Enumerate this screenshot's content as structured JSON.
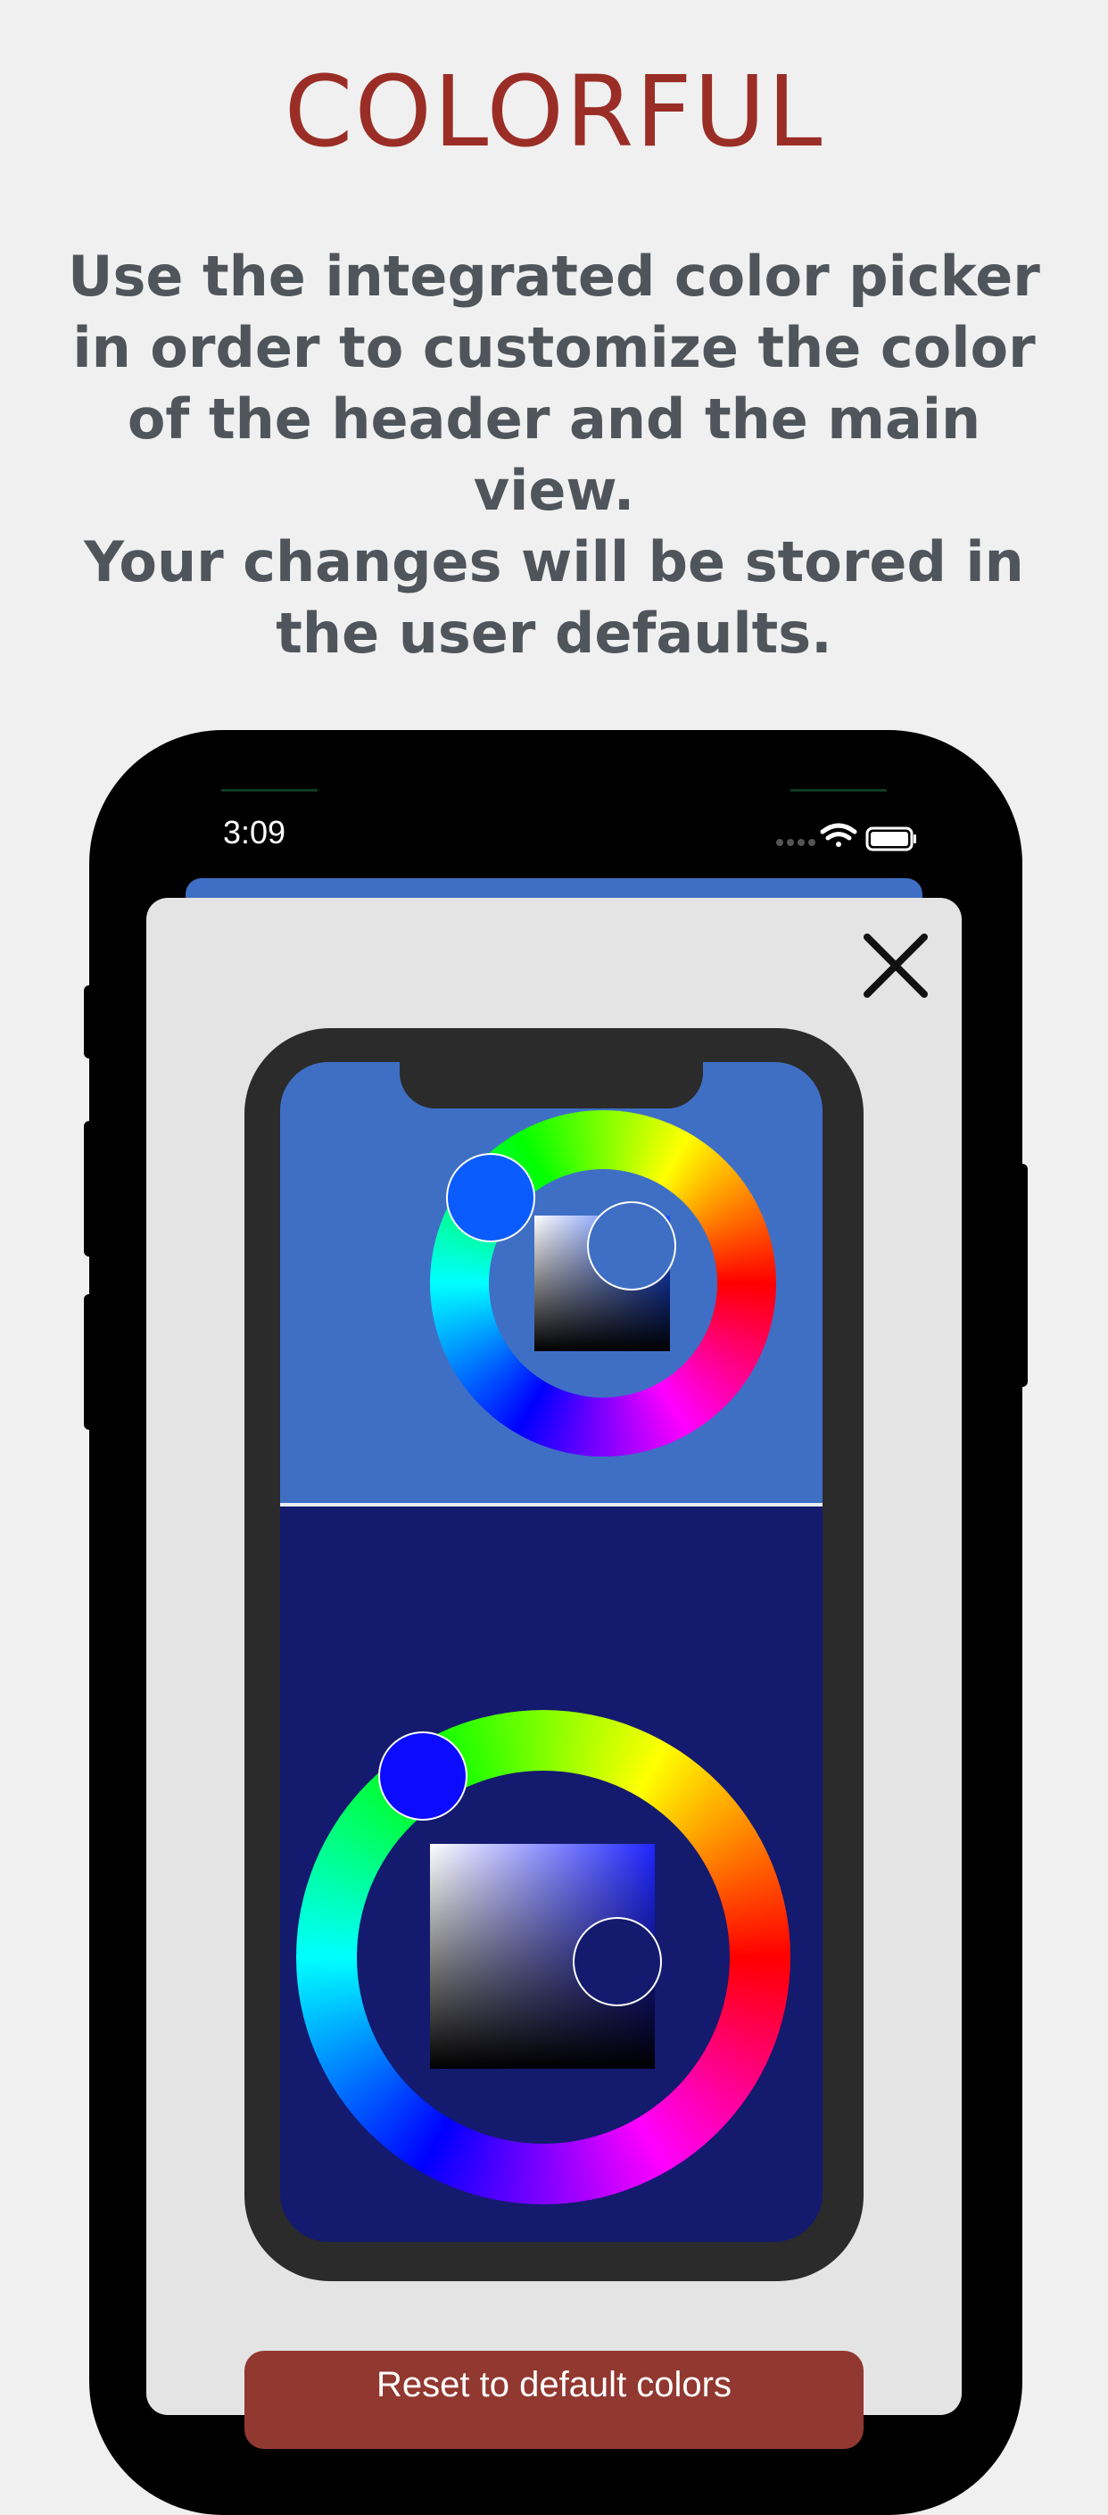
{
  "headline": "COLORFUL",
  "description_lines": [
    "Use the integrated color picker",
    "in order to customize the color",
    "of the header and the main",
    "view.",
    "Your changes will be stored in",
    "the user defaults."
  ],
  "status_bar": {
    "time": "3:09",
    "icons": [
      "signal-dots-icon",
      "wifi-icon",
      "battery-icon"
    ]
  },
  "close_icon": "close-icon",
  "preview": {
    "header_color": "#3f6fc4",
    "main_color": "#141a6e",
    "header_picker": {
      "hue_knob_color": "#0a5cff",
      "value_knob_color": "#3f6fc4"
    },
    "main_picker": {
      "hue_knob_color": "#0b0bff",
      "value_knob_color": "#141a6e"
    }
  },
  "reset_button": {
    "label": "Reset to default colors",
    "color": "#913830"
  },
  "colors": {
    "headline": "#9a2e26",
    "description": "#4f555b",
    "background": "#f0f0f0"
  }
}
